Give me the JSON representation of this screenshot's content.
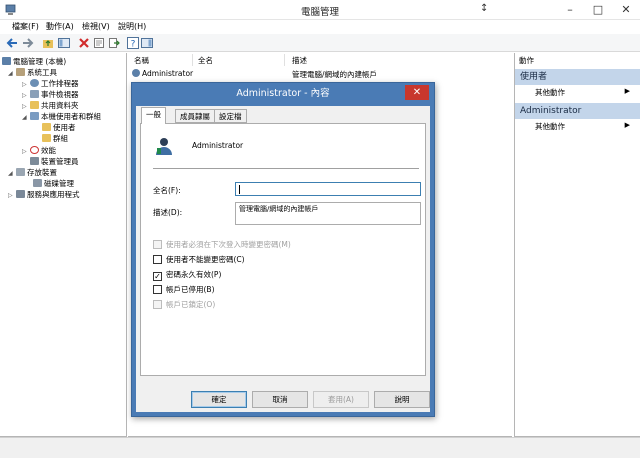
{
  "window": {
    "title": "電腦管理",
    "controls": {
      "minimize": "–",
      "maximize": "□",
      "close": "✕"
    }
  },
  "menu": [
    "檔案(F)",
    "動作(A)",
    "檢視(V)",
    "說明(H)"
  ],
  "toolbar": {
    "icons": [
      "back-arrow-icon",
      "forward-arrow-icon",
      "up-folder-icon",
      "show-hide-tree-icon",
      "delete-icon",
      "properties-icon",
      "export-icon",
      "help-icon",
      "action-pane-icon"
    ]
  },
  "tree": {
    "root": "電腦管理 (本機)",
    "system_tools": "系統工具",
    "task_scheduler": "工作排程器",
    "event_viewer": "事件檢視器",
    "shared_folders": "共用資料夾",
    "local_users_groups": "本機使用者和群組",
    "users": "使用者",
    "groups": "群組",
    "performance": "效能",
    "device_manager": "裝置管理員",
    "storage": "存放裝置",
    "disk_management": "磁碟管理",
    "services_apps": "服務與應用程式"
  },
  "list": {
    "columns": [
      "名稱",
      "全名",
      "描述"
    ],
    "row": {
      "name": "Administrator",
      "description": "管理電腦/網域的內建帳戶"
    }
  },
  "actions": {
    "header": "動作",
    "section1": "使用者",
    "section1_item": "其他動作",
    "section2": "Administrator",
    "section2_item": "其他動作"
  },
  "dialog": {
    "title": "Administrator - 內容",
    "close": "✕",
    "tabs": [
      "一般",
      "成員隸屬",
      "設定檔"
    ],
    "user_name": "Administrator",
    "fullname_label": "全名(F):",
    "fullname_value": "",
    "description_label": "描述(D):",
    "description_value": "管理電腦/網域的內建帳戶",
    "checkboxes": [
      {
        "label": "使用者必須在下次登入時變更密碼(M)",
        "checked": false,
        "disabled": true
      },
      {
        "label": "使用者不能變更密碼(C)",
        "checked": false,
        "disabled": false
      },
      {
        "label": "密碼永久有效(P)",
        "checked": true,
        "disabled": false
      },
      {
        "label": "帳戶已停用(B)",
        "checked": false,
        "disabled": false
      },
      {
        "label": "帳戶已鎖定(O)",
        "checked": false,
        "disabled": true
      }
    ],
    "buttons": {
      "ok": "確定",
      "cancel": "取消",
      "apply": "套用(A)",
      "help": "說明"
    }
  },
  "colors": {
    "dialog_frame": "#4a7bb5",
    "close_button": "#c8372d",
    "action_band": "#c3d5ea",
    "focus_border": "#3c7fb1"
  }
}
